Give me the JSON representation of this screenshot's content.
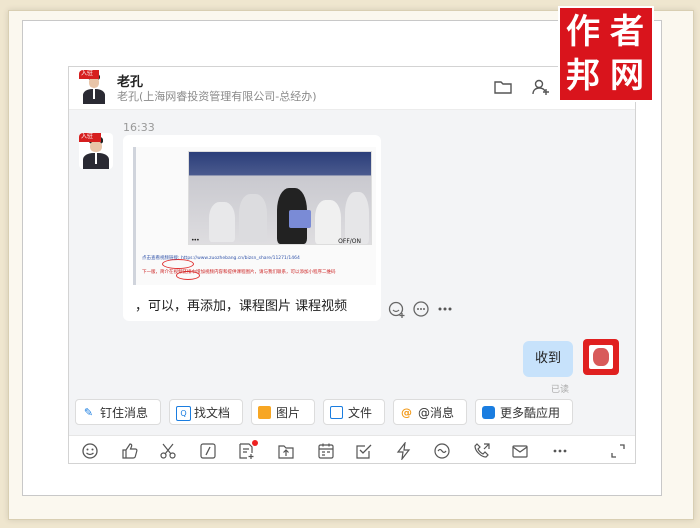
{
  "header": {
    "name": "老孔",
    "subtitle": "老孔(上海网睿投资管理有限公司-总经办)"
  },
  "avatar_tag": "入驻",
  "logo": {
    "chars": [
      "作",
      "者",
      "邦",
      "网"
    ]
  },
  "messages": {
    "time": "16:33",
    "screenshot_line1": "点击查看视频链接: https://www.zuozhebang.cn/bizsn_share/11271/1464",
    "screenshot_line2": "下一版，简介在视频链接中增加视频内容和提供课程图片，请与我们联系，可以添加小程序二维码",
    "photo_watermark": "OFF/ON",
    "photo_dots": "•••",
    "text": "，可以，再添加，课程图片   课程视频",
    "mine_text": "收到",
    "mine_status": "已读"
  },
  "quick_actions": [
    {
      "label": "钉住消息",
      "icon": "pin-icon"
    },
    {
      "label": "找文档",
      "icon": "search-doc-icon"
    },
    {
      "label": "图片",
      "icon": "image-icon"
    },
    {
      "label": "文件",
      "icon": "folder-icon"
    },
    {
      "label": "@消息",
      "icon": "at-icon"
    },
    {
      "label": "更多酷应用",
      "icon": "apps-icon"
    }
  ],
  "toolbar_icons": [
    "emoji-icon",
    "thumbs-up-icon",
    "scissors-icon",
    "slash-command-icon",
    "note-add-icon",
    "upload-folder-icon",
    "calendar-icon",
    "todo-check-icon",
    "lightning-icon",
    "chat-bubble-icon",
    "phone-call-icon",
    "mail-icon",
    "more-icon",
    "expand-icon"
  ],
  "colors": {
    "brand_red": "#d9141c",
    "my_bubble": "#c7e2fb",
    "accent_blue": "#1a7de0"
  }
}
